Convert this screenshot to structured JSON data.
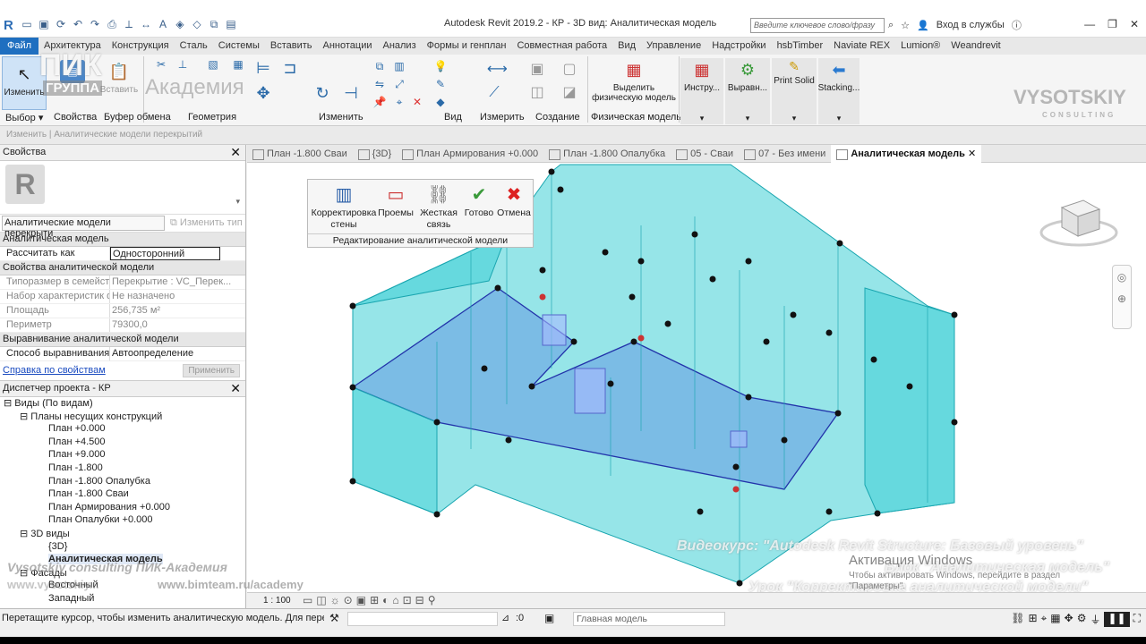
{
  "titlebar": {
    "title": "Autodesk Revit 2019.2 - КР - 3D вид: Аналитическая модель",
    "search_placeholder": "Введите ключевое слово/фразу",
    "signin": "Вход в службы"
  },
  "tabs": [
    "Файл",
    "Архитектура",
    "Конструкция",
    "Сталь",
    "Системы",
    "Вставить",
    "Аннотации",
    "Анализ",
    "Формы и генплан",
    "Совместная работа",
    "Вид",
    "Управление",
    "Надстройки",
    "hsbTimber",
    "Naviate REX",
    "Lumion®",
    "Weandrevit"
  ],
  "ribbon": {
    "modify": "Изменить",
    "properties": "Свойства",
    "paste": "Вставить",
    "select_footer": "Выбор",
    "clipboard_footer": "Буфер обмена",
    "geometry_footer": "Геометрия",
    "modify_footer": "Изменить",
    "view_footer": "Вид",
    "measure_footer": "Измерить",
    "create_footer": "Создание",
    "physical_btn": "Выделить физическую модель",
    "physical_footer": "Физическая модель",
    "tools_btn": "Инстру...",
    "align_btn": "Выравн...",
    "printsolid_btn": "Print Solid",
    "stacking_btn": "Stacking..."
  },
  "optionsbar": "Изменить | Аналитические модели перекрытий",
  "properties": {
    "header": "Свойства",
    "type_selector": "Аналитические модели перекрыти",
    "edit_type": "Изменить тип",
    "groups": [
      {
        "label": "Аналитическая модель",
        "rows": [
          {
            "k": "Рассчитать как",
            "v": "Односторонний",
            "dim": false,
            "boxed": true
          }
        ]
      },
      {
        "label": "Свойства аналитической модели",
        "rows": [
          {
            "k": "Типоразмер в семейст...",
            "v": "Перекрытие : VC_Перек...",
            "dim": true
          },
          {
            "k": "Набор характеристик ф...",
            "v": "Не назначено",
            "dim": true
          },
          {
            "k": "Площадь",
            "v": "256,735 м²",
            "dim": true
          },
          {
            "k": "Периметр",
            "v": "79300,0",
            "dim": true
          }
        ]
      },
      {
        "label": "Выравнивание аналитической модели",
        "rows": [
          {
            "k": "Способ выравнивания",
            "v": "Автоопределение",
            "dim": false
          }
        ]
      }
    ],
    "help_link": "Справка по свойствам",
    "apply": "Применить"
  },
  "browser": {
    "header": "Диспетчер проекта - КР",
    "nodes": [
      {
        "label": "Виды (По видам)",
        "level": 0,
        "toggle": "⊟"
      },
      {
        "label": "Планы несущих конструкций",
        "level": 1,
        "toggle": "⊟"
      },
      {
        "label": "План +0.000",
        "level": 2
      },
      {
        "label": "План +4.500",
        "level": 2
      },
      {
        "label": "План +9.000",
        "level": 2
      },
      {
        "label": "План -1.800",
        "level": 2
      },
      {
        "label": "План -1.800 Опалубка",
        "level": 2
      },
      {
        "label": "План -1.800 Сваи",
        "level": 2
      },
      {
        "label": "План Армирования +0.000",
        "level": 2
      },
      {
        "label": "План Опалубки +0.000",
        "level": 2
      },
      {
        "label": "3D виды",
        "level": 1,
        "toggle": "⊟"
      },
      {
        "label": "{3D}",
        "level": 2
      },
      {
        "label": "Аналитическая модель",
        "level": 2,
        "selected": true
      },
      {
        "label": "Фасады",
        "level": 1,
        "toggle": "⊟"
      },
      {
        "label": "Восточный",
        "level": 2
      },
      {
        "label": "Западный",
        "level": 2
      }
    ]
  },
  "viewtabs": [
    {
      "label": "План -1.800 Сваи",
      "active": false
    },
    {
      "label": "{3D}",
      "active": false
    },
    {
      "label": "План Армирования +0.000",
      "active": false
    },
    {
      "label": "План -1.800 Опалубка",
      "active": false
    },
    {
      "label": "05 - Сваи",
      "active": false
    },
    {
      "label": "07 - Без имени",
      "active": false
    },
    {
      "label": "Аналитическая модель",
      "active": true
    }
  ],
  "context_panel": {
    "buttons": [
      {
        "label": "Корректировка стены",
        "icon": "wall-adjust-icon"
      },
      {
        "label": "Проемы",
        "icon": "openings-icon"
      },
      {
        "label": "Жесткая связь",
        "icon": "rigid-link-icon"
      },
      {
        "label": "Готово",
        "icon": "check-icon"
      },
      {
        "label": "Отмена",
        "icon": "cancel-icon"
      }
    ],
    "footer": "Редактирование аналитической модели"
  },
  "view_controls": {
    "scale": "1 : 100"
  },
  "statusbar": {
    "message": "Перетащите курсор, чтобы изменить аналитическую модель. Для переключения",
    "count": ":0",
    "model": "Главная модель"
  },
  "watermarks": {
    "pik_logo": "ПИК",
    "pik_group": "ГРУППА",
    "academy": "Академия",
    "vysotskiy": "VYSOTSKIY",
    "consulting": "CONSULTING",
    "course": "Видеокурс: \"Autodesk Revit Structure: Базовый уровень\"",
    "block": "Блок \"Аналитическая модель\"",
    "lesson": "Урок \"Корректировка аналитической модели\"",
    "vc_pik": "Vysotskiy consulting  ПИК-Академия",
    "vc_url1": "www.vysotskiy...",
    "vc_url2": "www.bimteam.ru/academy",
    "activation_title": "Активация Windows",
    "activation_sub": "Чтобы активировать Windows, перейдите в раздел",
    "activation_sub2": "\"Параметры\"."
  },
  "colors": {
    "accent": "#1f6fc0",
    "model_fill": "#39c7cf",
    "model_stroke": "#1fa7b0",
    "slab": "#5b6fd8"
  }
}
